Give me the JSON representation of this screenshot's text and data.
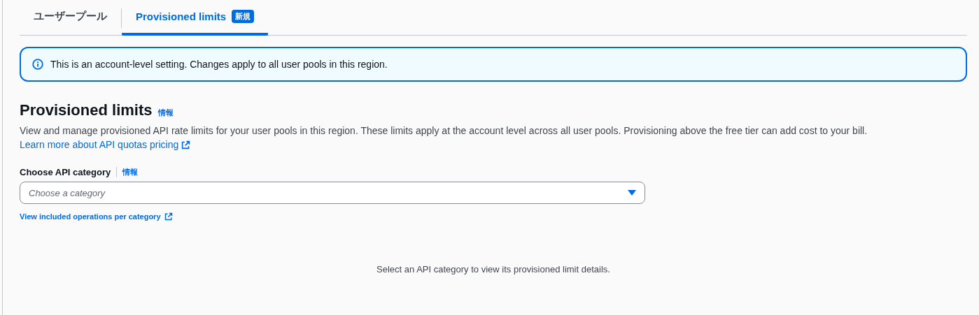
{
  "tabs": [
    {
      "label": "ユーザープール",
      "selected": false
    },
    {
      "label": "Provisioned limits",
      "selected": true,
      "badge": "新規"
    }
  ],
  "alert": {
    "text": "This is an account-level setting. Changes apply to all user pools in this region."
  },
  "section": {
    "title": "Provisioned limits",
    "info": "情報",
    "description": "View and manage provisioned API rate limits for your user pools in this region. These limits apply at the account level across all user pools. Provisioning above the free tier can add cost to your bill.",
    "link": "Learn more about API quotas pricing"
  },
  "field": {
    "label": "Choose API category",
    "info": "情報",
    "placeholder": "Choose a category",
    "help_link": "View included operations per category"
  },
  "empty_message": "Select an API category to view its provisioned limit details."
}
